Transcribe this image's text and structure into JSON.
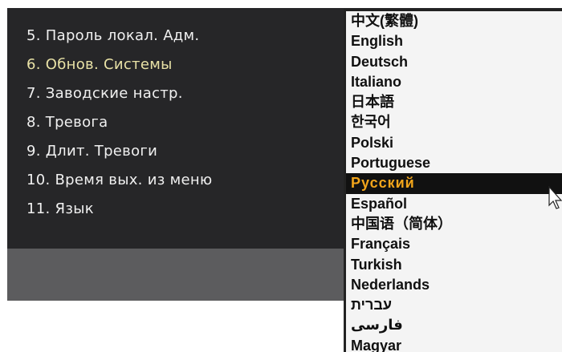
{
  "settings_menu": {
    "items": [
      {
        "num": "5.",
        "label": "Пароль локал. Адм."
      },
      {
        "num": "6.",
        "label": "Обнов. Системы"
      },
      {
        "num": "7.",
        "label": "Заводские настр."
      },
      {
        "num": "8.",
        "label": "Тревога"
      },
      {
        "num": "9.",
        "label": "Длит. Тревоги"
      },
      {
        "num": "10.",
        "label": "Время вых. из меню"
      },
      {
        "num": "11.",
        "label": "Язык"
      }
    ]
  },
  "language_dropdown": {
    "selected": "Русский",
    "options": [
      "中文(繁體)",
      "English",
      "Deutsch",
      "Italiano",
      "日本語",
      "한국어",
      "Polski",
      "Portuguese",
      "Русский",
      "Español",
      "中国语（简体）",
      "Français",
      "Turkish",
      "Nederlands",
      "עברית",
      "فارسی",
      "Magyar"
    ]
  },
  "colors": {
    "panel": "#262628",
    "highlight_text": "#f2a51b",
    "dropdown_bg": "#f4f4f4"
  },
  "icons": {
    "cursor": "mouse-pointer-icon"
  }
}
